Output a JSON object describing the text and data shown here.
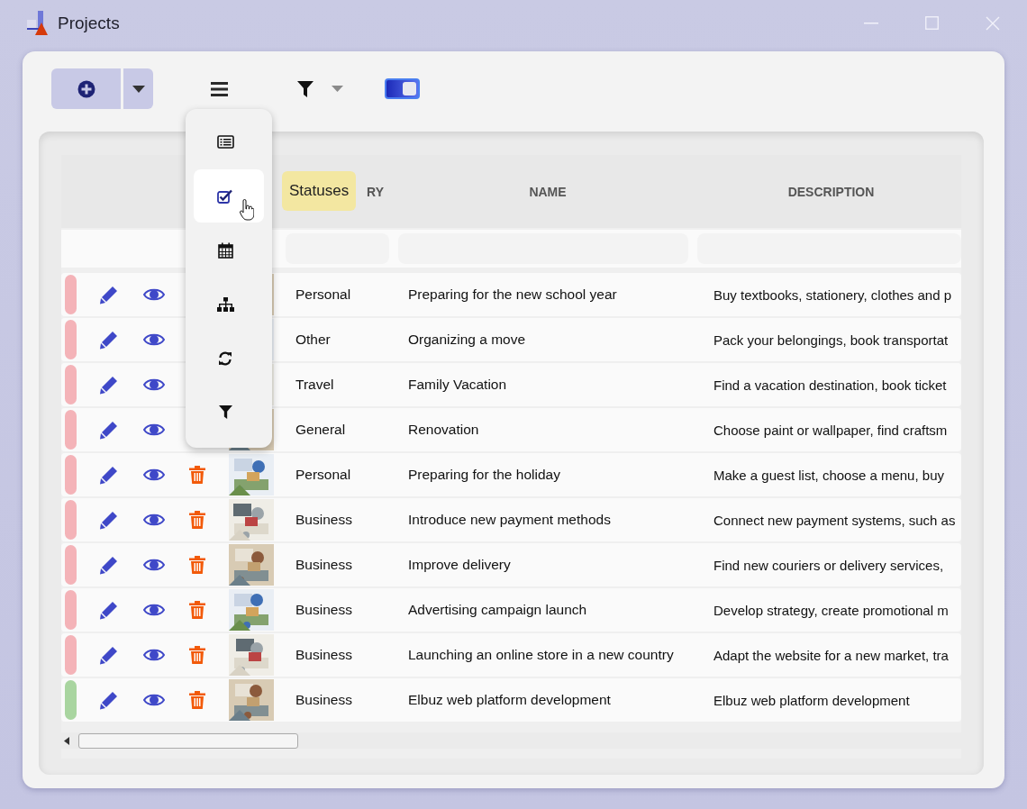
{
  "window": {
    "title": "Projects"
  },
  "toolbar": {
    "view_toggle": {
      "on": true
    }
  },
  "view_menu": {
    "items": [
      {
        "kind": "list",
        "selected": false
      },
      {
        "kind": "checklist",
        "selected": true
      },
      {
        "kind": "calendar",
        "selected": false
      },
      {
        "kind": "hierarchy",
        "selected": false
      },
      {
        "kind": "refresh",
        "selected": false
      },
      {
        "kind": "filter",
        "selected": false
      }
    ],
    "tooltip": "Statuses"
  },
  "table": {
    "columns": [
      "RY",
      "NAME",
      "DESCRIPTION"
    ],
    "rows": [
      {
        "color": "#f4b3b8",
        "actions": [
          {
            "kind": "edit"
          },
          {
            "kind": "view"
          }
        ],
        "category": "Personal",
        "name": "Preparing for the new school year",
        "description": "Buy textbooks, stationery, clothes and p"
      },
      {
        "color": "#f4b3b8",
        "actions": [
          {
            "kind": "edit"
          },
          {
            "kind": "view"
          }
        ],
        "category": "Other",
        "name": "Organizing a move",
        "description": "Pack your belongings, book transportat"
      },
      {
        "color": "#f4b3b8",
        "actions": [
          {
            "kind": "edit"
          },
          {
            "kind": "view"
          }
        ],
        "category": "Travel",
        "name": "Family Vacation",
        "description": "Find a vacation destination, book ticket"
      },
      {
        "color": "#f4b3b8",
        "actions": [
          {
            "kind": "edit"
          },
          {
            "kind": "view"
          }
        ],
        "category": "General",
        "name": "Renovation",
        "description": "Choose paint or wallpaper, find craftsm"
      },
      {
        "color": "#f4b3b8",
        "actions": [
          {
            "kind": "edit"
          },
          {
            "kind": "view"
          },
          {
            "kind": "delete"
          }
        ],
        "category": "Personal",
        "name": "Preparing for the holiday",
        "description": "Make a guest list, choose a menu, buy"
      },
      {
        "color": "#f4b3b8",
        "actions": [
          {
            "kind": "edit"
          },
          {
            "kind": "view"
          },
          {
            "kind": "delete"
          }
        ],
        "category": "Business",
        "name": "Introduce new payment methods",
        "description": "Connect new payment systems, such as"
      },
      {
        "color": "#f4b3b8",
        "actions": [
          {
            "kind": "edit"
          },
          {
            "kind": "view"
          },
          {
            "kind": "delete"
          }
        ],
        "category": "Business",
        "name": "Improve delivery",
        "description": "Find new couriers or delivery services,"
      },
      {
        "color": "#f4b3b8",
        "actions": [
          {
            "kind": "edit"
          },
          {
            "kind": "view"
          },
          {
            "kind": "delete"
          }
        ],
        "category": "Business",
        "name": "Advertising campaign launch",
        "description": "Develop strategy, create promotional m"
      },
      {
        "color": "#f4b3b8",
        "actions": [
          {
            "kind": "edit"
          },
          {
            "kind": "view"
          },
          {
            "kind": "delete"
          }
        ],
        "category": "Business",
        "name": "Launching an online store in a new country",
        "description": "Adapt the website for a new market, tra"
      },
      {
        "color": "#a9d5a0",
        "actions": [
          {
            "kind": "edit"
          },
          {
            "kind": "view"
          },
          {
            "kind": "delete"
          }
        ],
        "category": "Business",
        "name": "Elbuz web platform development",
        "description": "Elbuz web platform development"
      }
    ]
  }
}
